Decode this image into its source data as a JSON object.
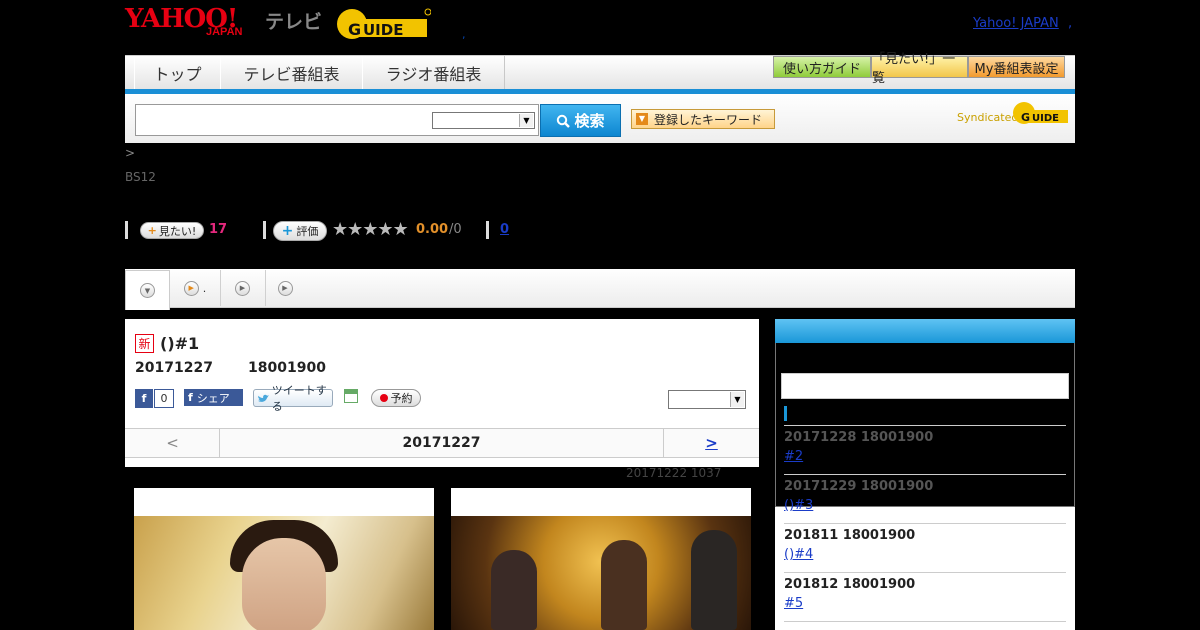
{
  "header": {
    "logo_yahoo": "YAHOO!",
    "logo_japan": "JAPAN",
    "logo_tv": "テレビ",
    "logo_gguide": "G GUIDE",
    "dot": ",",
    "yahoo_japan_link": "Yahoo! JAPAN",
    "yahoo_link_dot": ","
  },
  "nav": {
    "tabs": [
      {
        "label": "トップ"
      },
      {
        "label": "テレビ番組表"
      },
      {
        "label": "ラジオ番組表"
      }
    ],
    "right_buttons": [
      {
        "label": "使い方ガイド"
      },
      {
        "label": "「見たい!」一覧"
      },
      {
        "label": "My番組表設定"
      }
    ]
  },
  "search": {
    "value": "",
    "select_value": "",
    "button_label": "検索",
    "keyword_button": "登録したキーワード",
    "syndicated": "Syndicated",
    "syndicated_logo": "G GUIDE"
  },
  "breadcrumb": ">",
  "channel": "BS12",
  "stats": {
    "mitai_label": "見たい!",
    "mitai_count": "17",
    "hyoka_label": "評価",
    "stars": "★★★★★",
    "score": "0.00",
    "score_of": "/0",
    "count_link": "0"
  },
  "tabs": [
    {
      "label": ""
    },
    {
      "label": "."
    },
    {
      "label": ""
    },
    {
      "label": ""
    }
  ],
  "program": {
    "new_badge": "新",
    "title": "()#1",
    "date": "20171227",
    "time": "18001900",
    "fb_like_count": "0",
    "fb_share": "シェア",
    "tweet": "ツイートする",
    "reserve": "予約",
    "select_value": "",
    "pager_prev": "<",
    "pager_date": "20171227",
    "pager_next": ">",
    "updated": "20171222  1037"
  },
  "sidebar": {
    "episodes": [
      {
        "date": "20171228  18001900",
        "link": "#2"
      },
      {
        "date": "20171229  18001900",
        "link": "()#3"
      },
      {
        "date": "201811  18001900",
        "link": "()#4"
      },
      {
        "date": "201812  18001900",
        "link": "#5"
      }
    ]
  },
  "colors": {
    "accent_blue": "#1a97d8",
    "brand_red": "#e60012",
    "gguide_yellow": "#f2c300",
    "mitai_pink": "#e4287d",
    "score_orange": "#e2902a"
  },
  "icons": {
    "search": "search-icon",
    "record": "record-icon",
    "facebook": "facebook-icon",
    "twitter": "twitter-icon",
    "calendar": "calendar-icon"
  }
}
